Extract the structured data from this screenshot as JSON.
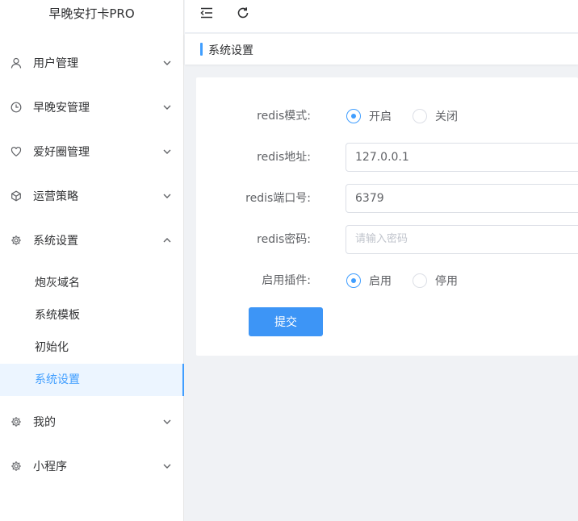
{
  "app": {
    "title": "早晚安打卡PRO"
  },
  "sidebar": {
    "menus": [
      {
        "label": "用户管理",
        "icon": "user-icon"
      },
      {
        "label": "早晚安管理",
        "icon": "clock-icon"
      },
      {
        "label": "爱好圈管理",
        "icon": "heart-icon"
      },
      {
        "label": "运营策略",
        "icon": "cube-icon"
      },
      {
        "label": "系统设置",
        "icon": "gear-icon",
        "expanded": true
      },
      {
        "label": "我的",
        "icon": "gear-icon"
      },
      {
        "label": "小程序",
        "icon": "gear-icon"
      }
    ],
    "submenu": [
      {
        "label": "炮灰域名"
      },
      {
        "label": "系统模板"
      },
      {
        "label": "初始化"
      },
      {
        "label": "系统设置",
        "active": true
      }
    ]
  },
  "breadcrumb": {
    "current": "系统设置"
  },
  "form": {
    "redis_mode": {
      "label": "redis模式:",
      "options": [
        "开启",
        "关闭"
      ],
      "selected": "开启"
    },
    "redis_addr": {
      "label": "redis地址:",
      "value": "127.0.0.1"
    },
    "redis_port": {
      "label": "redis端口号:",
      "value": "6379"
    },
    "redis_pwd": {
      "label": "redis密码:",
      "placeholder": "请输入密码"
    },
    "plugin": {
      "label": "启用插件:",
      "options": [
        "启用",
        "停用"
      ],
      "selected": "启用"
    },
    "submit_label": "提交"
  },
  "colors": {
    "accent": "#409eff",
    "button": "#3d95f6",
    "active_bg": "#ecf5ff"
  }
}
